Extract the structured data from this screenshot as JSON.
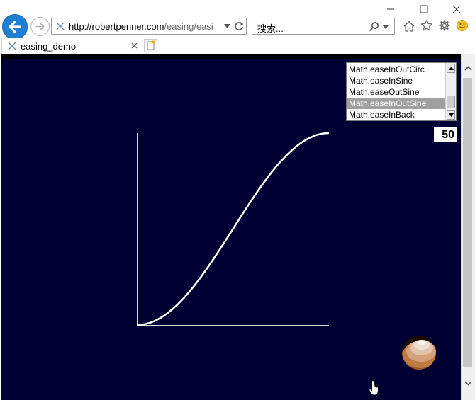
{
  "browser": {
    "url_host": "http://robertpenner.com",
    "url_rest": "/easing/easi",
    "search_placeholder": "搜索...",
    "tab_title": "easing_demo"
  },
  "listbox": {
    "items": [
      {
        "label": "Math.easeInOutCirc",
        "selected": false
      },
      {
        "label": "Math.easeInSine",
        "selected": false
      },
      {
        "label": "Math.easeOutSine",
        "selected": false
      },
      {
        "label": "Math.easeInOutSine",
        "selected": true
      },
      {
        "label": "Math.easeInBack",
        "selected": false
      }
    ]
  },
  "value_display": "50",
  "colors": {
    "content_bg": "#000033",
    "curve": "#ffffff",
    "selected_item": "#a0a0a0",
    "back_button": "#1f7fd3"
  }
}
